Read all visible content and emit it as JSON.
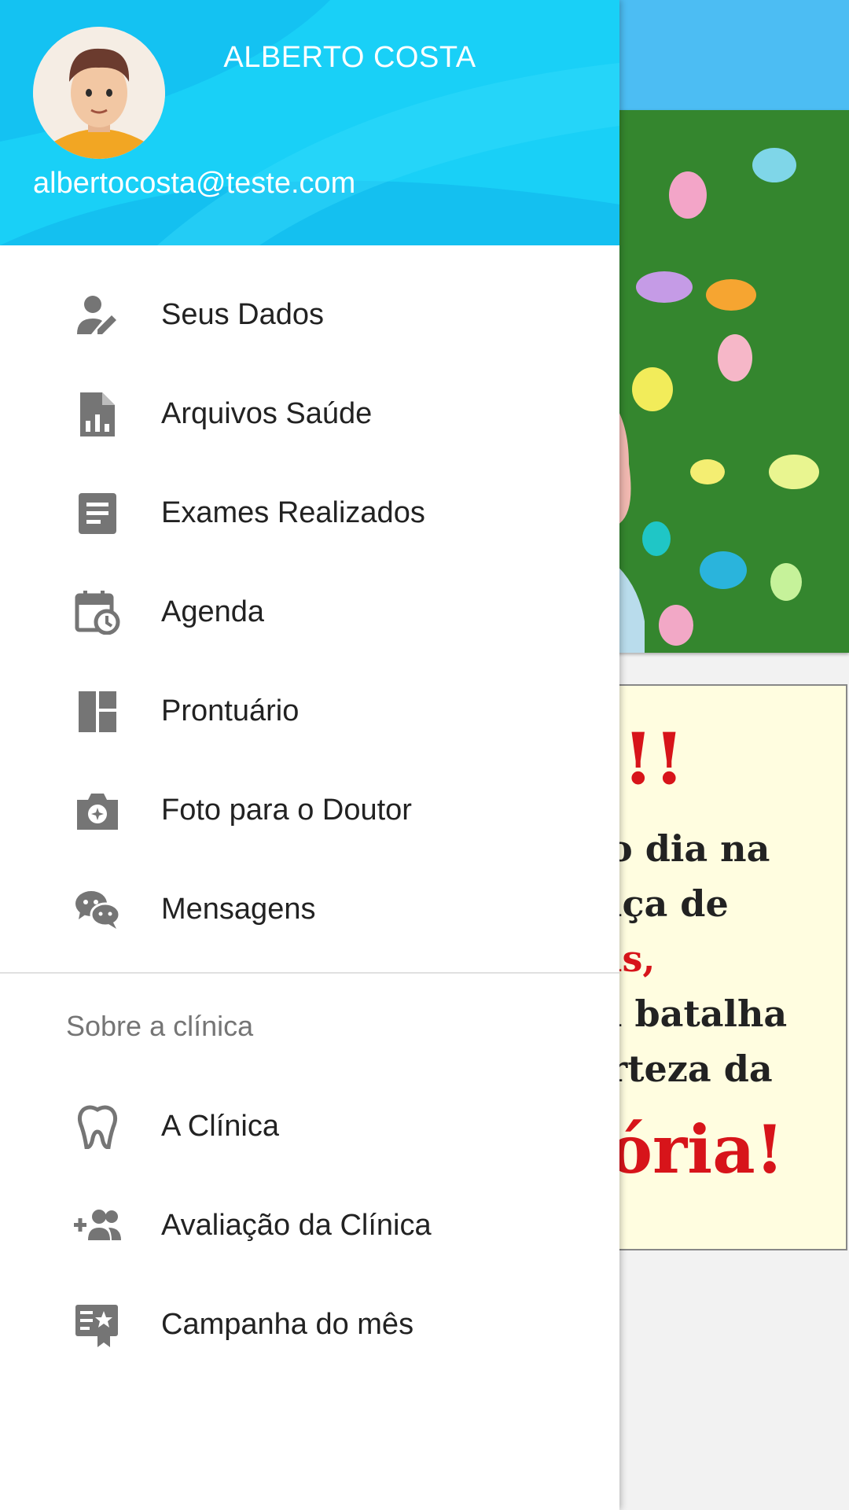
{
  "user": {
    "name": "ALBERTO COSTA",
    "email": "albertocosta@teste.com"
  },
  "menu": {
    "items": [
      {
        "label": "Seus Dados",
        "icon": "person-edit-icon"
      },
      {
        "label": "Arquivos Saúde",
        "icon": "file-chart-icon"
      },
      {
        "label": "Exames Realizados",
        "icon": "document-icon"
      },
      {
        "label": "Agenda",
        "icon": "calendar-clock-icon"
      },
      {
        "label": "Prontuário",
        "icon": "dashboard-icon"
      },
      {
        "label": "Foto para o Doutor",
        "icon": "camera-icon"
      },
      {
        "label": "Mensagens",
        "icon": "chat-icon"
      }
    ]
  },
  "section": {
    "title": "Sobre a clínica",
    "items": [
      {
        "label": "A Clínica",
        "icon": "tooth-icon"
      },
      {
        "label": "Avaliação da Clínica",
        "icon": "add-group-icon"
      },
      {
        "label": "Campanha do mês",
        "icon": "campaign-icon"
      }
    ]
  },
  "background": {
    "poster_lines": [
      "!!",
      "o dia na",
      "ıça de",
      "ıs,",
      "ı batalha",
      "rteza da",
      "ória!"
    ]
  },
  "colors": {
    "header": "#1ec8f5",
    "app_bar": "#4cbdf3",
    "icon": "#757575",
    "text": "#222222",
    "poster_red": "#d7141a"
  }
}
